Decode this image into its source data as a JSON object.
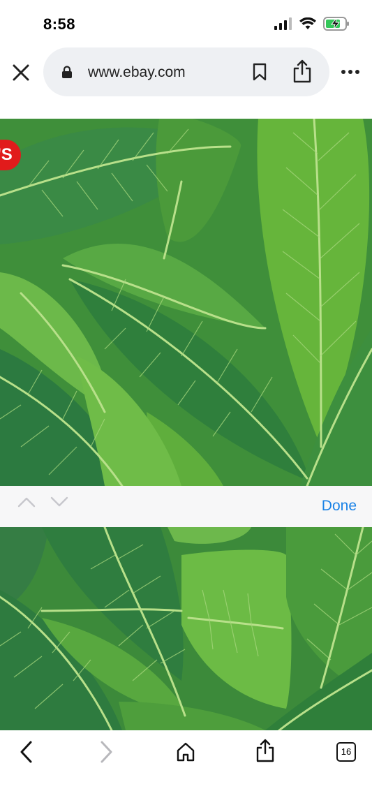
{
  "status_bar": {
    "time": "8:58"
  },
  "browser": {
    "url": "www.ebay.com"
  },
  "image": {
    "badge_text": "'S"
  },
  "find_bar": {
    "done_label": "Done"
  },
  "toolbar": {
    "tabs_count": "16"
  },
  "colors": {
    "accent": "#1a82e6",
    "badge": "#e11b1b",
    "leaf_dark": "#2f7a3e",
    "leaf_light": "#5fae3c"
  }
}
